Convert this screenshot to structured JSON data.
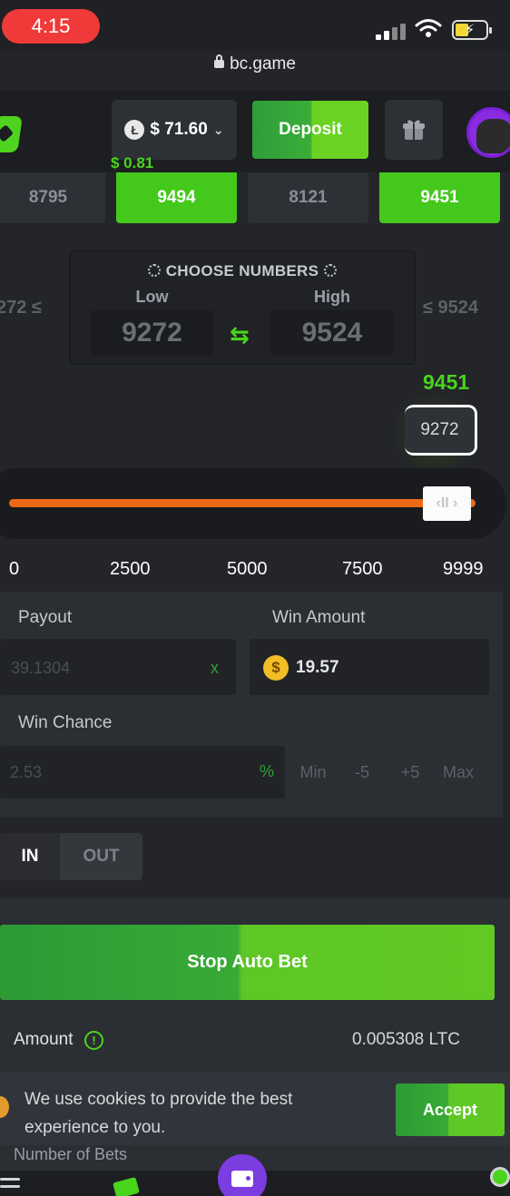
{
  "status_bar": {
    "time": "4:15",
    "url": "bc.game"
  },
  "header": {
    "balance": "$ 71.60",
    "balance_delta": "$ 0.81",
    "currency_icon": "ltc-icon",
    "deposit_label": "Deposit"
  },
  "recent_results": [
    "8795",
    "9494",
    "8121",
    "9451"
  ],
  "choose": {
    "title": "CHOOSE NUMBERS",
    "low_label": "Low",
    "high_label": "High",
    "low_value": "9272",
    "high_value": "9524",
    "left_side": "272 ≤",
    "right_side": "≤ 9524"
  },
  "result": {
    "value": "9451",
    "cube_value": "9272"
  },
  "slider": {
    "ticks": [
      "0",
      "2500",
      "5000",
      "7500",
      "9999"
    ],
    "handle_glyph": "‹II ›"
  },
  "payout": {
    "label": "Payout",
    "value": "39.1304",
    "suffix": "x"
  },
  "win_amount": {
    "label": "Win Amount",
    "value": "19.57",
    "coin": "$"
  },
  "win_chance": {
    "label": "Win Chance",
    "value": "2.53",
    "suffix": "%",
    "buttons": [
      "Min",
      "-5",
      "+5",
      "Max"
    ]
  },
  "mode_tabs": {
    "in": "IN",
    "out": "OUT"
  },
  "stop_button": "Stop Auto Bet",
  "amount": {
    "label": "Amount",
    "value": "0.005308 LTC"
  },
  "cookie": {
    "text": "We use cookies to provide the best experience to you.",
    "accept": "Accept"
  },
  "number_of_bets_label": "Number of Bets",
  "colors": {
    "accent_green": "#49d41c",
    "slider_orange": "#ec6a17",
    "bg": "#232529"
  }
}
